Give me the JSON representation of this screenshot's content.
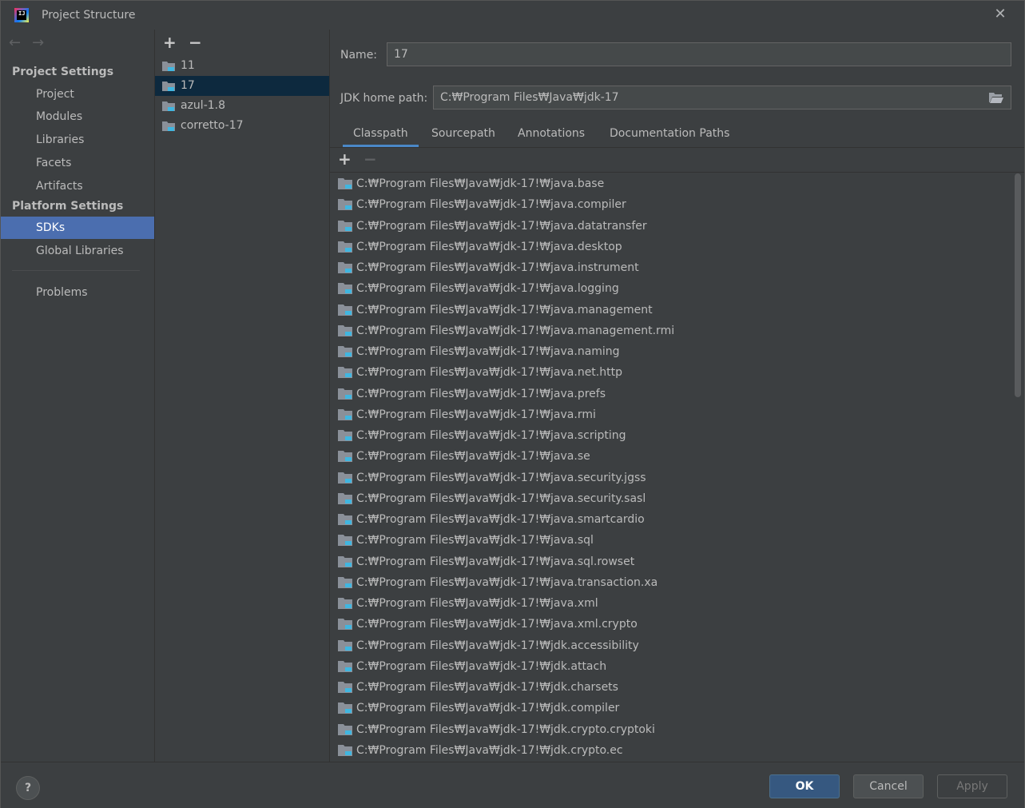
{
  "window": {
    "title": "Project Structure"
  },
  "nav": {
    "project_settings_header": "Project Settings",
    "project_items": [
      "Project",
      "Modules",
      "Libraries",
      "Facets",
      "Artifacts"
    ],
    "platform_settings_header": "Platform Settings",
    "platform_items": [
      "SDKs",
      "Global Libraries"
    ],
    "selected": "SDKs",
    "problems_label": "Problems"
  },
  "sdks": {
    "items": [
      "11",
      "17",
      "azul-1.8",
      "corretto-17"
    ],
    "selected": "17"
  },
  "details": {
    "name_label": "Name:",
    "name_value": "17",
    "jdk_label": "JDK home path:",
    "jdk_value": "C:₩Program Files₩Java₩jdk-17"
  },
  "tabs": [
    {
      "label": "Classpath",
      "active": true
    },
    {
      "label": "Sourcepath",
      "active": false
    },
    {
      "label": "Annotations",
      "active": false
    },
    {
      "label": "Documentation Paths",
      "active": false
    }
  ],
  "classpath": [
    "C:₩Program Files₩Java₩jdk-17!₩java.base",
    "C:₩Program Files₩Java₩jdk-17!₩java.compiler",
    "C:₩Program Files₩Java₩jdk-17!₩java.datatransfer",
    "C:₩Program Files₩Java₩jdk-17!₩java.desktop",
    "C:₩Program Files₩Java₩jdk-17!₩java.instrument",
    "C:₩Program Files₩Java₩jdk-17!₩java.logging",
    "C:₩Program Files₩Java₩jdk-17!₩java.management",
    "C:₩Program Files₩Java₩jdk-17!₩java.management.rmi",
    "C:₩Program Files₩Java₩jdk-17!₩java.naming",
    "C:₩Program Files₩Java₩jdk-17!₩java.net.http",
    "C:₩Program Files₩Java₩jdk-17!₩java.prefs",
    "C:₩Program Files₩Java₩jdk-17!₩java.rmi",
    "C:₩Program Files₩Java₩jdk-17!₩java.scripting",
    "C:₩Program Files₩Java₩jdk-17!₩java.se",
    "C:₩Program Files₩Java₩jdk-17!₩java.security.jgss",
    "C:₩Program Files₩Java₩jdk-17!₩java.security.sasl",
    "C:₩Program Files₩Java₩jdk-17!₩java.smartcardio",
    "C:₩Program Files₩Java₩jdk-17!₩java.sql",
    "C:₩Program Files₩Java₩jdk-17!₩java.sql.rowset",
    "C:₩Program Files₩Java₩jdk-17!₩java.transaction.xa",
    "C:₩Program Files₩Java₩jdk-17!₩java.xml",
    "C:₩Program Files₩Java₩jdk-17!₩java.xml.crypto",
    "C:₩Program Files₩Java₩jdk-17!₩jdk.accessibility",
    "C:₩Program Files₩Java₩jdk-17!₩jdk.attach",
    "C:₩Program Files₩Java₩jdk-17!₩jdk.charsets",
    "C:₩Program Files₩Java₩jdk-17!₩jdk.compiler",
    "C:₩Program Files₩Java₩jdk-17!₩jdk.crypto.cryptoki",
    "C:₩Program Files₩Java₩jdk-17!₩jdk.crypto.ec"
  ],
  "buttons": {
    "ok": "OK",
    "cancel": "Cancel",
    "apply": "Apply",
    "help": "?"
  },
  "colors": {
    "background": "#3c3f41",
    "selection": "#4b6eaf",
    "list_selection": "#0d293e",
    "ok_button": "#365880",
    "tab_underline": "#4a88c7"
  },
  "icons": {
    "sdk": "sdk-folder-icon",
    "classpath": "library-folder-icon",
    "jdk_browse": "folder-open-icon"
  }
}
